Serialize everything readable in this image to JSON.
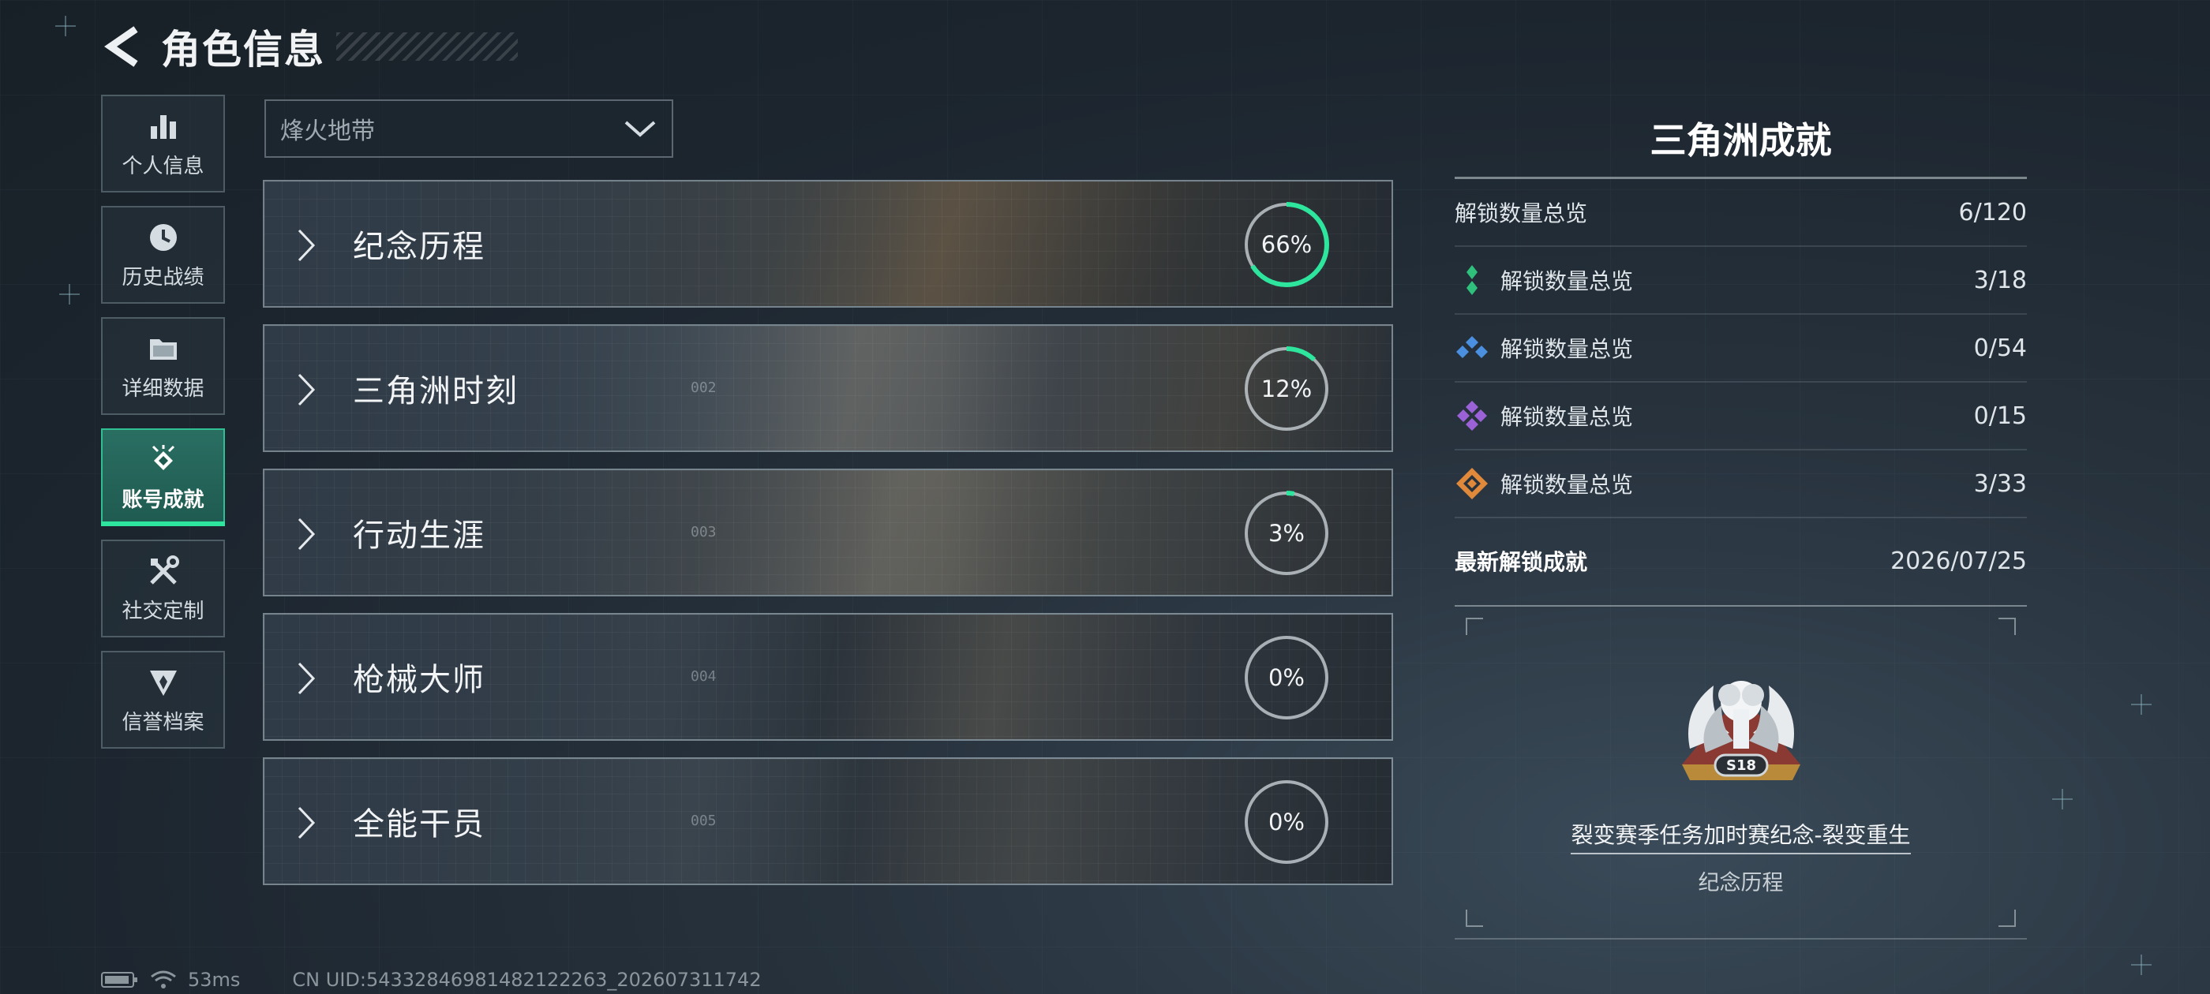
{
  "header": {
    "title": "角色信息"
  },
  "sidebar": {
    "items": [
      {
        "label": "个人信息",
        "icon": "bar-chart-icon",
        "active": false
      },
      {
        "label": "历史战绩",
        "icon": "history-icon",
        "active": false
      },
      {
        "label": "详细数据",
        "icon": "folder-icon",
        "active": false
      },
      {
        "label": "账号成就",
        "icon": "achievement-icon",
        "active": true
      },
      {
        "label": "社交定制",
        "icon": "tools-icon",
        "active": false
      },
      {
        "label": "信誉档案",
        "icon": "shield-icon",
        "active": false
      }
    ]
  },
  "mode_select": {
    "value": "烽火地带"
  },
  "categories": [
    {
      "name": "纪念历程",
      "num": "",
      "percent_label": "66%",
      "progress": 0.66
    },
    {
      "name": "三角洲时刻",
      "num": "002",
      "percent_label": "12%",
      "progress": 0.12
    },
    {
      "name": "行动生涯",
      "num": "003",
      "percent_label": "3%",
      "progress": 0.03
    },
    {
      "name": "枪械大师",
      "num": "004",
      "percent_label": "0%",
      "progress": 0
    },
    {
      "name": "全能干员",
      "num": "005",
      "percent_label": "0%",
      "progress": 0
    }
  ],
  "summary": {
    "title": "三角洲成就",
    "total": {
      "label": "解锁数量总览",
      "value": "6/120"
    },
    "tiers": [
      {
        "label": "解锁数量总览",
        "value": "3/18",
        "color": "#2fc07c",
        "icon": "green-diamond-icon"
      },
      {
        "label": "解锁数量总览",
        "value": "0/54",
        "color": "#4a8fe0",
        "icon": "blue-diamond-icon"
      },
      {
        "label": "解锁数量总览",
        "value": "0/15",
        "color": "#9b62d8",
        "icon": "purple-diamond-icon"
      },
      {
        "label": "解锁数量总览",
        "value": "3/33",
        "color": "#e0893a",
        "icon": "orange-diamond-icon"
      }
    ],
    "latest": {
      "label": "最新解锁成就",
      "date": "2026/07/25",
      "achievement_name": "裂变赛季任务加时赛纪念-裂变重生",
      "achievement_category": "纪念历程",
      "badge_text": "S18"
    }
  },
  "status_bar": {
    "ping": "53ms",
    "uid": "CN UID:54332846981482122263_202607311742"
  },
  "colors": {
    "accent": "#2ee59d",
    "ring_track": "#c8d0d5"
  }
}
